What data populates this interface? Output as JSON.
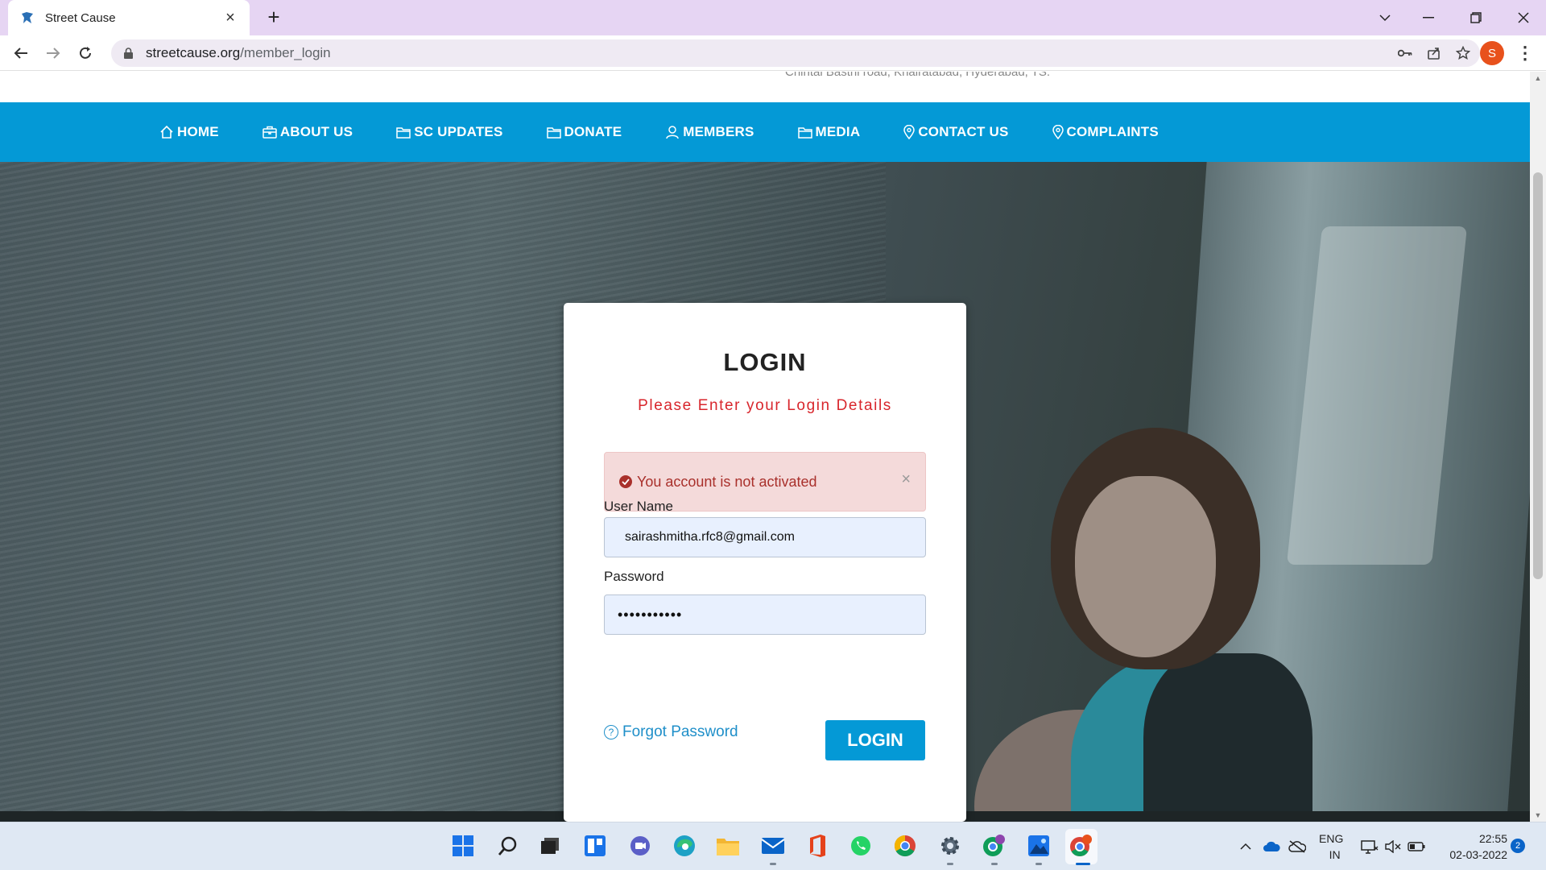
{
  "browser": {
    "tab_title": "Street Cause",
    "url_domain": "streetcause.org",
    "url_path": "/member_login",
    "profile_initial": "S"
  },
  "site": {
    "address_partial": "Chintal Basthi road, Khairatabad, Hyderabad, TS.",
    "nav": [
      {
        "label": "HOME",
        "icon": "home-icon"
      },
      {
        "label": "ABOUT US",
        "icon": "briefcase-icon"
      },
      {
        "label": "SC UPDATES",
        "icon": "folder-icon"
      },
      {
        "label": "DONATE",
        "icon": "folder-icon"
      },
      {
        "label": "MEMBERS",
        "icon": "user-icon"
      },
      {
        "label": "MEDIA",
        "icon": "folder-icon"
      },
      {
        "label": "CONTACT US",
        "icon": "map-pin-icon"
      },
      {
        "label": "COMPLAINTS",
        "icon": "map-pin-icon"
      }
    ]
  },
  "login": {
    "title": "LOGIN",
    "subtitle": "Please Enter your Login Details",
    "alert": "You account is not activated",
    "alert_close": "×",
    "username_label": "User Name",
    "username_value": "sairashmitha.rfc8@gmail.com",
    "password_label": "Password",
    "password_value": "•••••••••••",
    "forgot_label": "Forgot Password",
    "submit_label": "LOGIN"
  },
  "taskbar": {
    "lang_top": "ENG",
    "lang_bottom": "IN",
    "time": "22:55",
    "date": "02-03-2022",
    "notifications": "2"
  },
  "colors": {
    "nav_bg": "#0499d6",
    "subtitle": "#d8262c",
    "alert_bg": "#f4dada",
    "alert_text": "#a9302b",
    "link": "#1f8fc9"
  }
}
